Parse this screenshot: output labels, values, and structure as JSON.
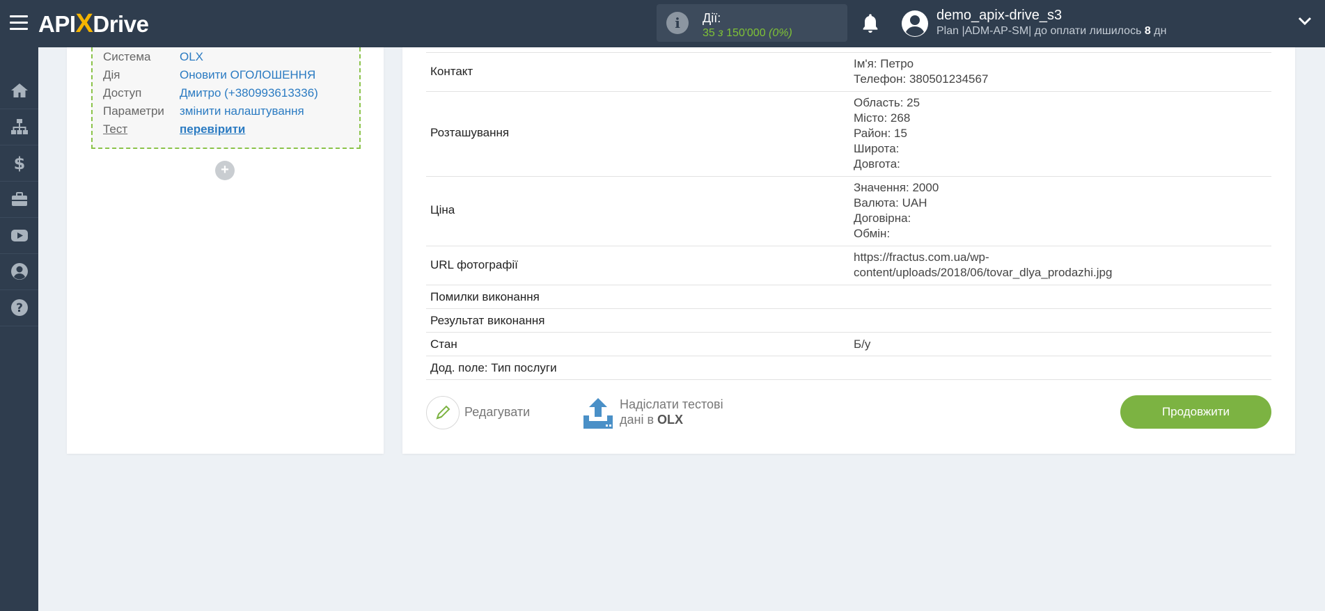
{
  "header": {
    "logo": {
      "left": "API",
      "x": "X",
      "right": "Drive"
    },
    "actions": {
      "label": "Дії:",
      "count": "35",
      "of_word": "з",
      "total": "150'000",
      "percent": "(0%)"
    },
    "user": {
      "name": "demo_apix-drive_s3",
      "plan_text": "Plan |ADM-AP-SM| до оплати лишилось",
      "days": "8",
      "days_unit": "дн"
    },
    "icons": [
      "hamburger-icon",
      "info-icon",
      "bell-icon",
      "user-avatar-icon",
      "chevron-down-icon"
    ]
  },
  "sidebar": {
    "items": [
      {
        "icon": "home-icon"
      },
      {
        "icon": "sitemap-icon"
      },
      {
        "icon": "dollar-icon"
      },
      {
        "icon": "briefcase-icon"
      },
      {
        "icon": "youtube-icon"
      },
      {
        "icon": "user-circle-icon"
      },
      {
        "icon": "help-icon"
      }
    ]
  },
  "connection": {
    "rows": [
      {
        "key": "Система",
        "value": "OLX"
      },
      {
        "key": "Дія",
        "value": "Оновити ОГОЛОШЕННЯ"
      },
      {
        "key": "Доступ",
        "value": "Дмитро (+380993613336)"
      },
      {
        "key": "Параметри",
        "value": "змінити налаштування"
      },
      {
        "key": "Тест",
        "value": "перевірити"
      }
    ],
    "add_symbol": "+"
  },
  "fields": [
    {
      "name": "Контакт",
      "values": [
        "Ім'я: Петро",
        "Телефон: 380501234567"
      ]
    },
    {
      "name": "Розташування",
      "values": [
        "Область: 25",
        "Місто: 268",
        "Район: 15",
        "Широта:",
        "Довгота:"
      ]
    },
    {
      "name": "Ціна",
      "values": [
        "Значення: 2000",
        "Валюта: UAH",
        "Договірна:",
        "Обмін:"
      ]
    },
    {
      "name": "URL фотографії",
      "values": [
        "https://fractus.com.ua/wp-",
        "content/uploads/2018/06/tovar_dlya_prodazhi.jpg"
      ]
    },
    {
      "name": "Помилки виконання",
      "values": []
    },
    {
      "name": "Результат виконання",
      "values": []
    },
    {
      "name": "Стан",
      "values": [
        "Б/у"
      ]
    },
    {
      "name": "Дод. поле: Тип послуги",
      "values": []
    }
  ],
  "buttons": {
    "edit": "Редагувати",
    "send_line1": "Надіслати тестові",
    "send_line2_prefix": "дані в",
    "send_target": "OLX",
    "continue": "Продовжити"
  },
  "colors": {
    "sidebar": "#2f3d4e",
    "accent_green": "#7cb342",
    "link_blue": "#2b7bc2",
    "logo_x": "#f5b400"
  }
}
